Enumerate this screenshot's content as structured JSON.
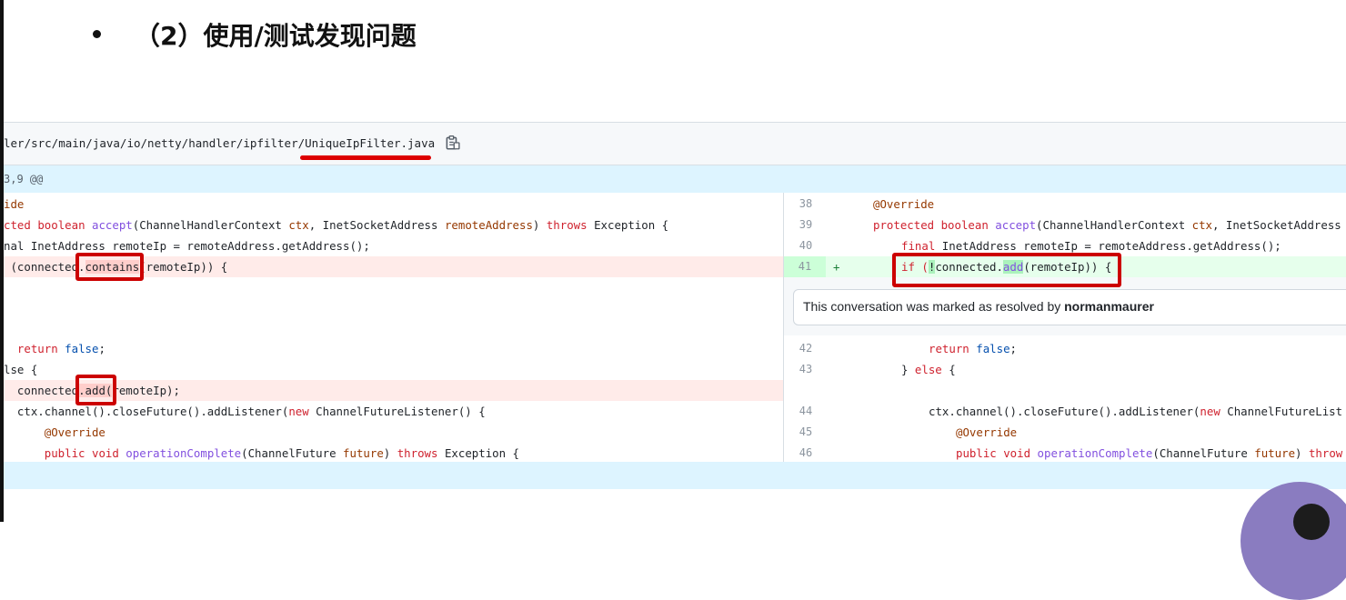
{
  "slide": {
    "title": "（2）使用/测试发现问题"
  },
  "file_header": {
    "path_prefix": "ler/src/main/java/io/netty/handler/ipfilter/",
    "file_name": "UniqueIpFilter.java",
    "copy_icon": "clipboard-icon"
  },
  "hunk": {
    "header": "3,9 @@"
  },
  "left_lines": [
    {
      "text": "ide"
    },
    {
      "pre": "cted ",
      "kw1": "boolean ",
      "fn": "accept",
      "mid": "(ChannelHandlerContext ",
      "p1": "ctx",
      "mid2": ", InetSocketAddress ",
      "p2": "remoteAddress",
      "mid3": ") ",
      "kw2": "throws",
      "end": " Exception {"
    },
    {
      "text": "nal InetAddress remoteIp = remoteAddress.getAddress();"
    },
    {
      "pre": " (connected.",
      "hl": "contains",
      "end": "(remoteIp)) {"
    },
    {
      "pre": "  ",
      "kw": "return",
      "sp": " ",
      "val": "false",
      "end": ";"
    },
    {
      "text": "lse {"
    },
    {
      "pre": "  connected",
      "hl": ".add(",
      "end": "remoteIp);"
    },
    {
      "text": "  ctx.channel().closeFuture().addListener(",
      "kw": "new",
      "end": " ChannelFutureListener() {"
    },
    {
      "text": "      @Override"
    },
    {
      "pre": "      public ",
      "kw": "void ",
      "fn": "operationComplete",
      "mid": "(ChannelFuture ",
      "p1": "future",
      "mid2": ") ",
      "kw2": "throws",
      "end": " Exception {"
    }
  ],
  "right_lines": [
    {
      "num": "38",
      "text": "@Override"
    },
    {
      "num": "39",
      "kw1": "protected boolean ",
      "fn": "accept",
      "mid": "(ChannelHandlerContext ",
      "p1": "ctx",
      "end": ", InetSocketAddress"
    },
    {
      "num": "40",
      "kw": "final",
      "end": " InetAddress remoteIp = remoteAddress.getAddress();"
    },
    {
      "num": "41",
      "sign": "+",
      "pre": "if (",
      "bang": "!",
      "mid": "connected.",
      "fn": "add",
      "end": "(remoteIp)) {"
    },
    {
      "num": "42",
      "kw": "return",
      "sp": " ",
      "val": "false",
      "end": ";"
    },
    {
      "num": "43",
      "text": "} ",
      "kw": "else",
      "end": " {"
    },
    {
      "num": "44",
      "text": "ctx.channel().closeFuture().addListener(",
      "kw": "new",
      "end": " ChannelFutureList"
    },
    {
      "num": "45",
      "text": "@Override"
    },
    {
      "num": "46",
      "kw1": "public void ",
      "fn": "operationComplete",
      "mid": "(ChannelFuture ",
      "p1": "future",
      "mid2": ") ",
      "kw2": "throw"
    }
  ],
  "conversation": {
    "text": "This conversation was marked as resolved by ",
    "user": "normanmaurer"
  }
}
